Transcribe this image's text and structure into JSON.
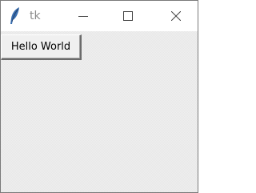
{
  "window": {
    "title": "tk",
    "icon": "feather-icon",
    "controls": {
      "minimize_icon": "minimize-icon",
      "maximize_icon": "maximize-icon",
      "close_icon": "close-icon"
    }
  },
  "content": {
    "hello_button_label": "Hello World"
  },
  "colors": {
    "titlebar": "#ffffff",
    "client_background": "#efefef",
    "title_text": "#8a8a8a",
    "icon_blue": "#3a6fb0"
  }
}
